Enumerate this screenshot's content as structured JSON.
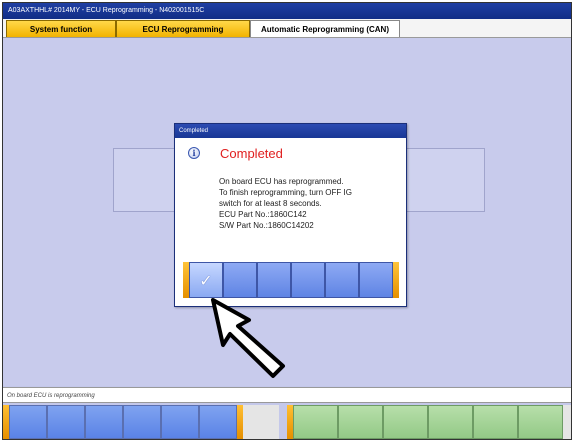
{
  "window": {
    "title": "A03AXTHHL# 2014MY   -   ECU Reprogramming   -   N402001515C"
  },
  "tabs": [
    {
      "label": "System function"
    },
    {
      "label": "ECU Reprogramming"
    },
    {
      "label": "Automatic Reprogramming (CAN)"
    }
  ],
  "status": {
    "text": "On board ECU is reprogramming"
  },
  "dialog": {
    "title": "Completed",
    "heading": "Completed",
    "icon": "info-icon",
    "message_lines": [
      "On board ECU has reprogrammed.",
      "To finish reprogramming, turn OFF IG",
      "switch for at least 8 seconds.",
      "ECU Part No.:1860C142",
      "S/W Part No.:1860C14202"
    ],
    "ok_icon": "check-icon"
  },
  "colors": {
    "title_bar": "#1f3fa3",
    "tab_active": "#f2b300",
    "dialog_heading": "#e02020",
    "workspace": "#c8cbec",
    "fkey_blue": "#5a83e6",
    "fkey_green": "#93c986"
  }
}
